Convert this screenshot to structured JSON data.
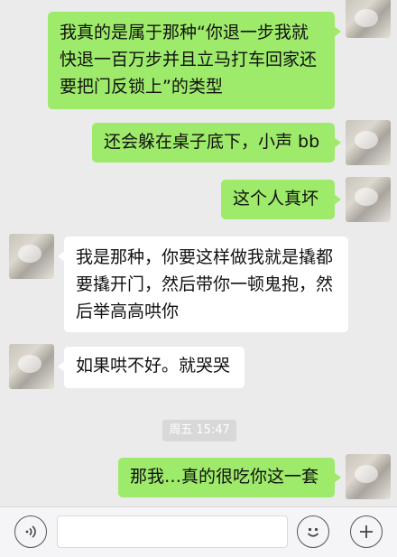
{
  "messages": [
    {
      "side": "right",
      "text": "我真的是属于那种“你退一步我就快退一百万步并且立马打车回家还要把门反锁上”的类型"
    },
    {
      "side": "right",
      "text": "还会躲在桌子底下，小声 bb"
    },
    {
      "side": "right",
      "text": "这个人真坏"
    },
    {
      "side": "left",
      "text": "我是那种，你要这样做我就是撬都要撬开门，然后带你一顿鬼抱，然后举高高哄你"
    },
    {
      "side": "left",
      "text": "如果哄不好。就哭哭"
    },
    {
      "side": "right",
      "text": "那我…真的很吃你这一套"
    }
  ],
  "timestamp": "周五 15:47",
  "input_bar": {
    "voice_icon": "voice-wave-icon",
    "emoji_icon": "smiley-face-icon",
    "plus_icon": "plus-icon",
    "input_value": ""
  },
  "colors": {
    "chat_background": "#ebebeb",
    "sent_bubble": "#9eea6a",
    "received_bubble": "#ffffff"
  }
}
